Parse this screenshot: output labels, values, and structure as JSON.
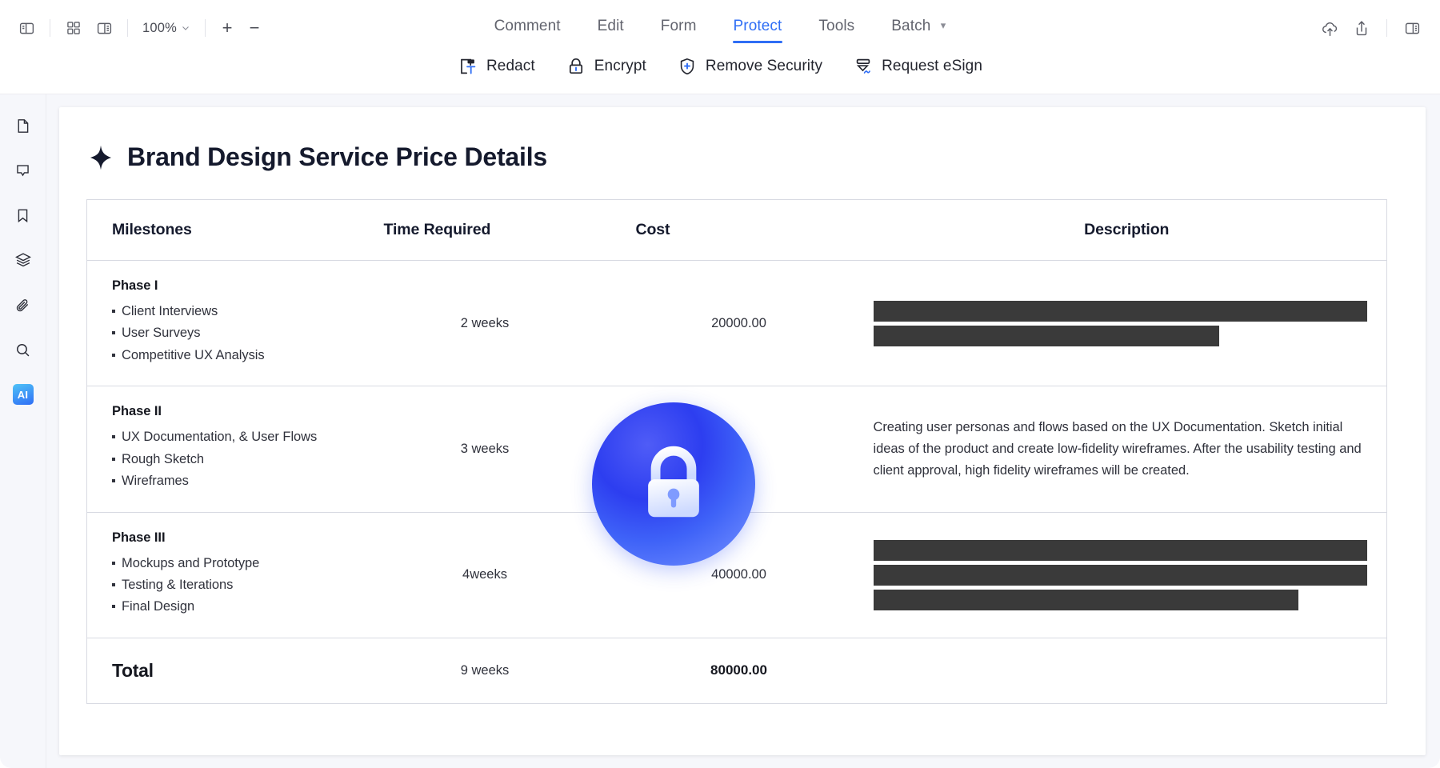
{
  "toolbar": {
    "zoom_level": "100%",
    "left_icons": [
      {
        "name": "sidebar-toggle-icon",
        "label": "Sidebar"
      },
      {
        "name": "grid-view-icon",
        "label": "Grid view"
      },
      {
        "name": "page-layout-icon",
        "label": "Page layout"
      }
    ],
    "zoom_in_label": "+",
    "zoom_out_label": "−",
    "right_icons": [
      {
        "name": "cloud-upload-icon",
        "label": "Upload to cloud"
      },
      {
        "name": "share-icon",
        "label": "Share"
      },
      {
        "name": "right-panel-icon",
        "label": "Right panel"
      }
    ],
    "tabs": [
      {
        "label": "Comment",
        "active": false,
        "caret": false
      },
      {
        "label": "Edit",
        "active": false,
        "caret": false
      },
      {
        "label": "Form",
        "active": false,
        "caret": false
      },
      {
        "label": "Protect",
        "active": true,
        "caret": false
      },
      {
        "label": "Tools",
        "active": false,
        "caret": false
      },
      {
        "label": "Batch",
        "active": false,
        "caret": true
      }
    ],
    "protect_tools": [
      {
        "label": "Redact",
        "icon": "redact-icon"
      },
      {
        "label": "Encrypt",
        "icon": "lock-icon"
      },
      {
        "label": "Remove Security",
        "icon": "shield-plus-icon"
      },
      {
        "label": "Request eSign",
        "icon": "esign-icon"
      }
    ],
    "accent_color": "#2f6ef5"
  },
  "sidebar": {
    "items": [
      {
        "label": "Thumbnails",
        "icon": "page-icon"
      },
      {
        "label": "Comments",
        "icon": "comment-icon"
      },
      {
        "label": "Bookmarks",
        "icon": "bookmark-icon"
      },
      {
        "label": "Layers",
        "icon": "layers-icon"
      },
      {
        "label": "Attachments",
        "icon": "paperclip-icon"
      },
      {
        "label": "Search",
        "icon": "search-icon"
      },
      {
        "label": "AI Assistant",
        "icon": "ai-icon",
        "badge_text": "AI"
      }
    ]
  },
  "document": {
    "title": "Brand Design Service Price Details",
    "title_icon": "sparkle-icon",
    "table": {
      "headers": [
        "Milestones",
        "Time Required",
        "Cost",
        "Description"
      ],
      "rows": [
        {
          "phase": "Phase I",
          "bullets": [
            "Client Interviews",
            "User Surveys",
            "Competitive UX Analysis"
          ],
          "time": "2 weeks",
          "cost": "20000.00",
          "description": "",
          "redacted": true,
          "redaction_bars": [
            {
              "width": "100%"
            },
            {
              "width": "70%"
            }
          ]
        },
        {
          "phase": "Phase II",
          "bullets": [
            "UX Documentation, & User Flows",
            "Rough Sketch",
            "Wireframes"
          ],
          "time": "3 weeks",
          "cost": "",
          "description": "Creating user personas and flows based on the UX Documentation. Sketch initial ideas of the product and create low-fidelity wireframes. After the usability testing and client approval, high fidelity wireframes will be created.",
          "redacted": false,
          "redaction_bars": []
        },
        {
          "phase": "Phase III",
          "bullets": [
            "Mockups and Prototype",
            "Testing & Iterations",
            "Final Design"
          ],
          "time": "4weeks",
          "cost": "40000.00",
          "description": "",
          "redacted": true,
          "redaction_bars": [
            {
              "width": "100%"
            },
            {
              "width": "100%"
            },
            {
              "width": "86%"
            }
          ]
        }
      ],
      "total": {
        "label": "Total",
        "time": "9 weeks",
        "cost": "80000.00",
        "description": ""
      }
    },
    "overlay": {
      "icon": "lock-icon",
      "description": "Encrypted document lock badge"
    },
    "redaction_color": "#3a3a3a"
  }
}
